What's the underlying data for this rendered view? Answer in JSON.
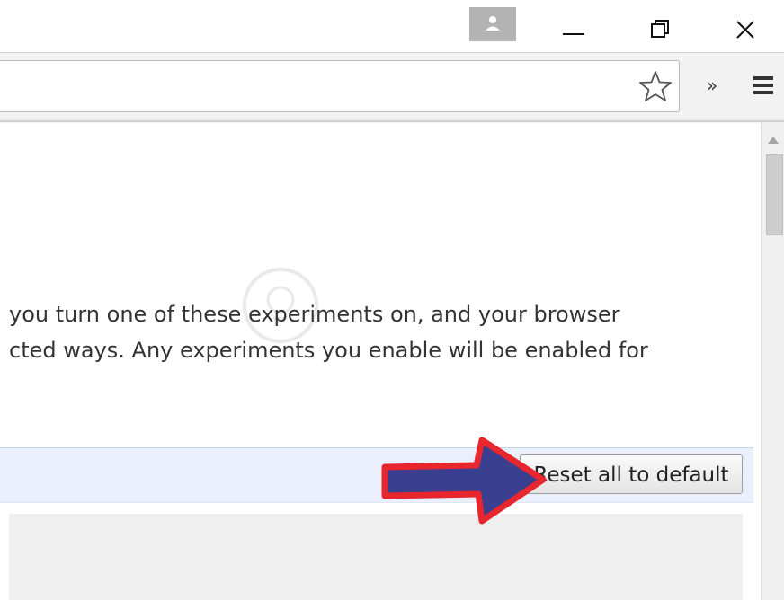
{
  "titlebar": {
    "profile_icon": "person-icon",
    "minimize_icon": "minimize-icon",
    "restore_icon": "restore-icon",
    "close_icon": "close-icon"
  },
  "toolbar": {
    "bookmark_icon": "star-icon",
    "extensions_label": "»",
    "menu_icon": "hamburger-menu-icon"
  },
  "content": {
    "warning_line1": "you turn one of these experiments on, and your browser",
    "warning_line2": "cted ways. Any experiments you enable will be enabled for",
    "reset_button_label": "Reset all to default"
  },
  "annotation": {
    "arrow_fill": "#3a3f8f",
    "arrow_stroke": "#e8262d"
  }
}
